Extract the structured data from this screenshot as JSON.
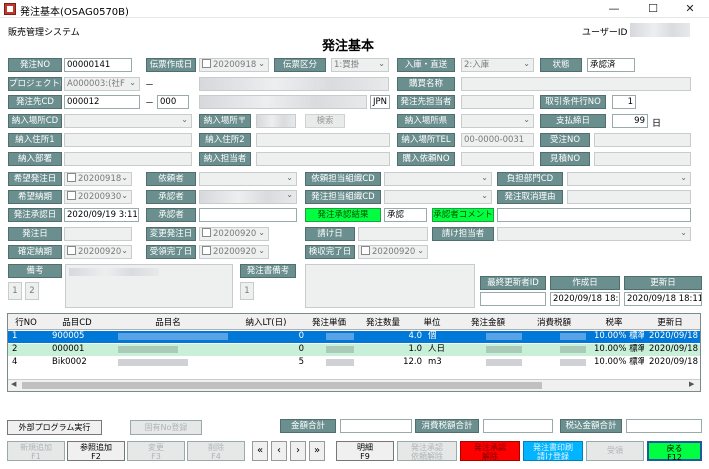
{
  "window": {
    "title": "発注基本(OSAG0570B)",
    "minimize": "—",
    "maximize": "☐",
    "close": "✕"
  },
  "header": {
    "system": "販売管理システム",
    "title": "発注基本",
    "user_label": "ユーザーID"
  },
  "form": {
    "order_no_label": "発注NO",
    "order_no": "00000141",
    "slip_date_label": "伝票作成日",
    "slip_date": "20200918",
    "slip_type_label": "伝票区分",
    "slip_type": "1:買掛",
    "inout_label": "入庫・直送",
    "inout": "2:入庫",
    "status_label": "状態",
    "status": "承認済",
    "project_label": "プロジェクトID",
    "project_id": "A000003:(社F",
    "dash1": "－",
    "contract_name_label": "購買名称",
    "supplier_label": "発注先CD",
    "supplier_cd": "000012",
    "dash2": "－",
    "supplier_sub": "000",
    "currency": "JPN",
    "supplier_person_label": "発注先担当者",
    "terms_label": "取引条件行NO",
    "terms_no": "1",
    "delivery_cd_label": "納入場所CD",
    "delivery_zip_label": "納入場所〒",
    "search_btn": "検索",
    "delivery_pref_label": "納入場所県",
    "payday_label": "支払締日",
    "payday": "99",
    "payday_unit": "日",
    "addr1_label": "納入住所1",
    "addr2_label": "納入住所2",
    "delivery_tel_label": "納入場所TEL",
    "delivery_tel": "00-0000-0031",
    "order_recv_no_label": "受注NO",
    "dept_label": "納入部署",
    "delivery_person_label": "納入担当者",
    "purchase_req_label": "購入依頼NO",
    "quote_no_label": "見積NO",
    "want_date_label": "希望発注日",
    "want_date": "20200918",
    "requester_label": "依頼者",
    "req_org_label": "依頼担当組織CD",
    "burden_dept_label": "負担部門CD",
    "want_delivery_label": "希望納期",
    "want_delivery": "20200930",
    "approver_label": "承認者",
    "order_org_label": "発注担当組織CD",
    "cancel_reason_label": "発注取消理由",
    "approve_date_label": "発注承認日",
    "approve_date": "2020/09/19 3:11:0",
    "approver2_label": "承認者",
    "approve_result_label": "発注承認結果",
    "approve_result": "承認",
    "approve_comment_label": "承認者コメント",
    "order_date_label": "発注日",
    "change_order_date_label": "変更発注日",
    "change_order_date": "20200920",
    "contract_date_label": "請け日",
    "contract_person_label": "請け担当者",
    "fixed_delivery_label": "確定納期",
    "fixed_delivery": "20200920",
    "receipt_done_label": "受領完了日",
    "receipt_done": "20200920",
    "inspect_done_label": "検収完了日",
    "inspect_done": "20200920",
    "remarks_label": "備考",
    "remarks_page1": "1",
    "remarks_page2": "2",
    "slip_remarks_label": "発注書備考",
    "slip_remarks_page1": "1",
    "last_updater_label": "最終更新者ID",
    "created_label": "作成日",
    "created": "2020/09/18 18:11",
    "updated_label": "更新日",
    "updated": "2020/09/18 18:11"
  },
  "grid": {
    "headers": [
      "行NO",
      "品目CD",
      "品目名",
      "納入LT(日)",
      "発注単価",
      "発注数量",
      "単位",
      "発注金額",
      "消費税額",
      "税率",
      "更新日"
    ],
    "rows": [
      {
        "line": "1",
        "cd": "900005",
        "lt": "0",
        "qty": "4.0",
        "unit": "個",
        "rate": "10.00% 標準",
        "upd": "2020/09/18"
      },
      {
        "line": "2",
        "cd": "000001",
        "lt": "0",
        "qty": "1.0",
        "unit": "人日",
        "rate": "10.00% 標準",
        "upd": "2020/09/18"
      },
      {
        "line": "4",
        "cd": "Bik0002",
        "lt": "5",
        "qty": "12.0",
        "unit": "m3",
        "rate": "10.00% 標準",
        "upd": "2020/09/18"
      }
    ],
    "scroll_left": "◀",
    "scroll_right": "▶"
  },
  "footer": {
    "external_btn": "外部プログラム実行",
    "fixed_no_btn": "固有No登録",
    "total_label": "金額合計",
    "tax_total_label": "消費税額合計",
    "tax_incl_label": "税込金額合計",
    "buttons": {
      "new": [
        "新規追加",
        "F1"
      ],
      "ref_add": [
        "参照追加",
        "F2"
      ],
      "change": [
        "変更",
        "F3"
      ],
      "delete": [
        "削除",
        "F4"
      ],
      "first": "«",
      "prev": "‹",
      "next": "›",
      "last": "»",
      "detail": [
        "明細",
        "F9"
      ],
      "approve_req": [
        "発注承認",
        "依頼解除"
      ],
      "approve_cancel": [
        "発注承認",
        "解除"
      ],
      "print_save": [
        "発注書印刷",
        "請け登録"
      ],
      "receipt": "受領",
      "back": [
        "戻る",
        "F12"
      ]
    }
  },
  "colors": {
    "label_bg": "#6b8e8e",
    "selected_row": "#0078d7",
    "row_green": "#c8f0d8",
    "approve_green": "#00ff40",
    "red_btn": "#ff0000",
    "cyan_btn": "#00b4ff",
    "back_btn": "#00ff40"
  }
}
